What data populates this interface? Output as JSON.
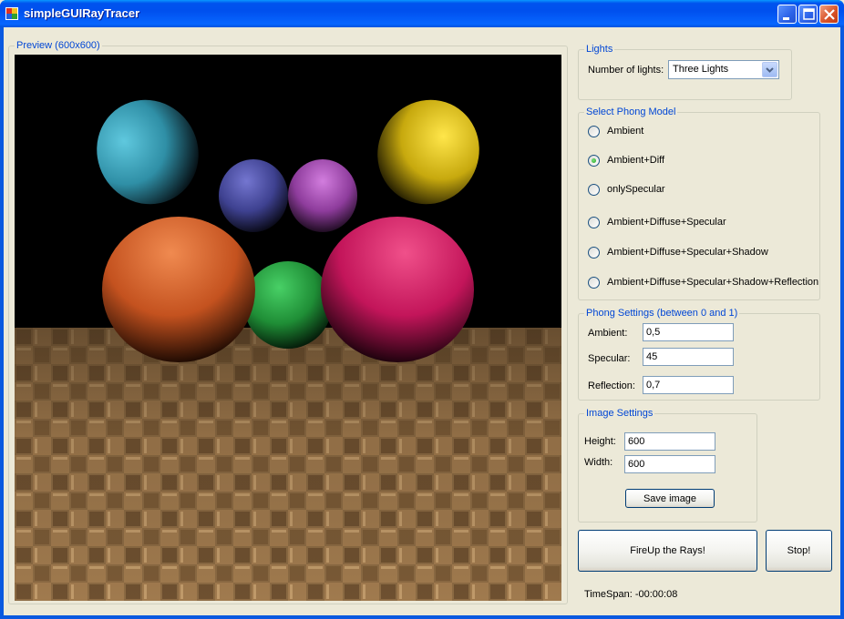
{
  "window": {
    "title": "simpleGUIRayTracer"
  },
  "preview": {
    "group_label": "Preview (600x600)",
    "sky_color": "#000000",
    "floor_color": "#8B6A43",
    "spheres": [
      {
        "name": "teal",
        "color": "#3AA0B8"
      },
      {
        "name": "yellow",
        "color": "#E4C514"
      },
      {
        "name": "indigo",
        "color": "#4A4C9E"
      },
      {
        "name": "magenta",
        "color": "#A34BB0"
      },
      {
        "name": "green",
        "color": "#2EAA46"
      },
      {
        "name": "orange",
        "color": "#E06530"
      },
      {
        "name": "pink",
        "color": "#E0206A"
      }
    ]
  },
  "lights": {
    "group_label": "Lights",
    "count_label": "Number of lights:",
    "count_value": "Three Lights"
  },
  "phong_model": {
    "group_label": "Select Phong Model",
    "options": [
      {
        "label": "Ambient",
        "checked": false
      },
      {
        "label": "Ambient+Diff",
        "checked": true
      },
      {
        "label": "onlySpecular",
        "checked": false
      },
      {
        "label": "Ambient+Diffuse+Specular",
        "checked": false
      },
      {
        "label": "Ambient+Diffuse+Specular+Shadow",
        "checked": false
      },
      {
        "label": "Ambient+Diffuse+Specular+Shadow+Reflection",
        "checked": false
      }
    ]
  },
  "phong_settings": {
    "group_label": "Phong Settings (between 0 and 1)",
    "ambient_label": "Ambient:",
    "ambient_value": "0,5",
    "specular_label": "Specular:",
    "specular_value": "45",
    "reflection_label": "Reflection:",
    "reflection_value": "0,7"
  },
  "image_settings": {
    "group_label": "Image Settings",
    "height_label": "Height:",
    "height_value": "600",
    "width_label": "Width:",
    "width_value": "600",
    "save_label": "Save image"
  },
  "actions": {
    "fire_label": "FireUp the Rays!",
    "stop_label": "Stop!",
    "timespan_text": "TimeSpan: -00:00:08"
  }
}
